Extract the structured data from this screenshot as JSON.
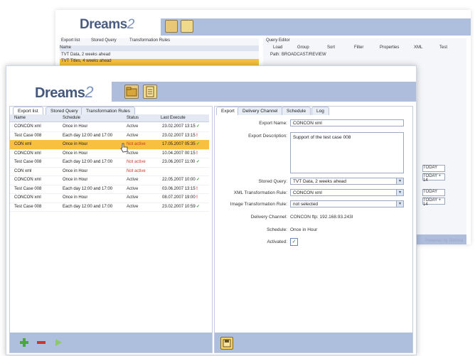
{
  "background_window": {
    "logo_text": "Dreams",
    "logo_version": "2",
    "left_tabs": [
      "Export list",
      "Stored Query",
      "Transformation Rules"
    ],
    "left_column": "Name",
    "left_rows": [
      "TVT Data, 2 weeks ahead",
      "TVT Titles, 4 weeks ahead"
    ],
    "right_title": "Query Editor",
    "right_tabs": [
      "Load",
      "Group",
      "Sort",
      "Filter",
      "Properties",
      "XML",
      "Test"
    ],
    "path_label": "Path:",
    "path_value": "BROADCAST/REVIEW",
    "side_labels": [
      "TODAY",
      "TODAY + 14",
      "TODAY",
      "TODAY + 14"
    ],
    "powered_by": "Powered by Sitecha"
  },
  "header": {
    "logo_text": "Dreams",
    "logo_version": "2"
  },
  "left_panel": {
    "tabs": [
      "Export list",
      "Stored Query",
      "Transformation Rules"
    ],
    "columns": [
      "Name",
      "Schedule",
      "Status",
      "Last Execute"
    ],
    "rows": [
      {
        "name": "CONCON xml",
        "schedule": "Once in Hour",
        "status": "Active",
        "last": "23.02.2007 13:15",
        "mark": "✓",
        "mark_type": "ok"
      },
      {
        "name": "Test Case 008",
        "schedule": "Each day 12:00 and 17:00",
        "status": "Active",
        "last": "23.02.2007 13:15",
        "mark": "!",
        "mark_type": "bad"
      },
      {
        "name": "CON xml",
        "schedule": "Once in Hour",
        "status": "Not active",
        "last": "17.05.2007 05:35",
        "mark": "✓",
        "mark_type": "ok"
      },
      {
        "name": "CONCON xml",
        "schedule": "Once in Hour",
        "status": "Active",
        "last": "10.04.2007 00:15",
        "mark": "!",
        "mark_type": "bad"
      },
      {
        "name": "Test Case 008",
        "schedule": "Each day 12:00 and 17:00",
        "status": "Not active",
        "last": "23.06.2007 11:00",
        "mark": "✓",
        "mark_type": "ok"
      },
      {
        "name": "CON xml",
        "schedule": "Once in Hour",
        "status": "Not active",
        "last": "",
        "mark": "",
        "mark_type": "ok"
      },
      {
        "name": "CONCON xml",
        "schedule": "Once in Hour",
        "status": "Active",
        "last": "22.05.2007 10:00",
        "mark": "✓",
        "mark_type": "ok"
      },
      {
        "name": "Test Case 008",
        "schedule": "Each day 12:00 and 17:00",
        "status": "Active",
        "last": "03.06.2007 13:15",
        "mark": "!",
        "mark_type": "bad"
      },
      {
        "name": "CONCON xml",
        "schedule": "Once in Hour",
        "status": "Active",
        "last": "08.07.2007 19:00",
        "mark": "!",
        "mark_type": "bad"
      },
      {
        "name": "Test Case 008",
        "schedule": "Each day 12:00 and 17:00",
        "status": "Active",
        "last": "23.02.2007 10:59",
        "mark": "✓",
        "mark_type": "ok"
      }
    ],
    "selected_row": 2
  },
  "right_panel": {
    "tabs": [
      "Export",
      "Delivery Channel",
      "Schedule",
      "Log"
    ],
    "labels": {
      "export_name": "Export Name:",
      "export_description": "Export Description:",
      "stored_query": "Stored Query:",
      "xml_rule": "XML Transformation Rule:",
      "image_rule": "Image Transformation Rule:",
      "delivery_channel": "Delivery Channel:",
      "schedule": "Schedule:",
      "activated": "Activated:"
    },
    "values": {
      "export_name": "CONCON xml",
      "export_description": "Support of the test case 008",
      "stored_query": "TVT Data, 2 weeks ahead",
      "xml_rule": "CONCON xml",
      "image_rule": "not selected",
      "delivery_channel": "CONCON ftp: 192.168.93.243l",
      "schedule": "Once in Hour",
      "activated": "✓"
    }
  },
  "colors": {
    "accent_bar": "#adbddb",
    "selected_row": "#f7c03e",
    "not_active": "#d03a2a",
    "ok": "#3a9d3a"
  }
}
